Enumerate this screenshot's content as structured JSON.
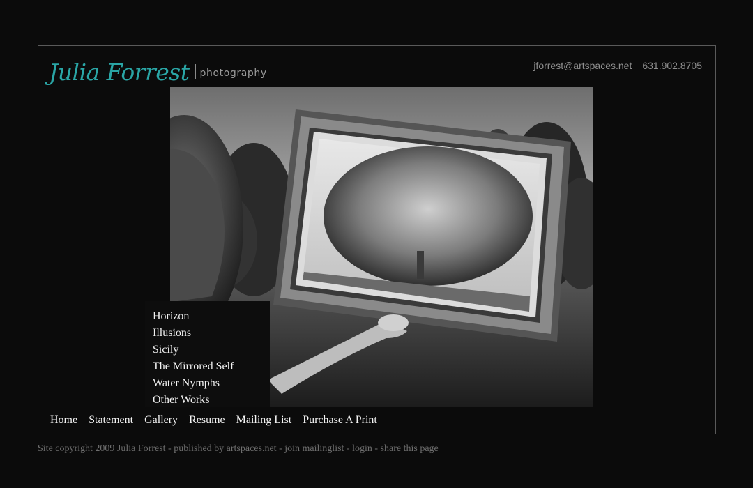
{
  "header": {
    "logo_name": "Julia Forrest",
    "logo_subtitle": "photography",
    "email": "jforrest@artspaces.net",
    "phone": "631.902.8705"
  },
  "photo": {
    "icon": "photograph-woman-holding-frame"
  },
  "submenu": {
    "items": [
      {
        "label": "Horizon"
      },
      {
        "label": "Illusions"
      },
      {
        "label": "Sicily"
      },
      {
        "label": "The Mirrored Self"
      },
      {
        "label": "Water Nymphs"
      },
      {
        "label": "Other Works"
      }
    ]
  },
  "nav": {
    "items": [
      {
        "label": "Home"
      },
      {
        "label": "Statement"
      },
      {
        "label": "Gallery"
      },
      {
        "label": "Resume"
      },
      {
        "label": "Mailing List"
      },
      {
        "label": "Purchase A Print"
      }
    ]
  },
  "footer": {
    "copyright": "Site copyright 2009 Julia Forrest",
    "sep1": " - ",
    "published": "published by artspaces.net",
    "sep2": " - ",
    "join": "join mailinglist",
    "sep3": " - ",
    "login": "login",
    "sep4": " - ",
    "share": "share this page"
  },
  "colors": {
    "background": "#0b0b0b",
    "logo_accent": "#2aa6a6",
    "nav_text": "#f4f4f4",
    "muted_text": "#6e6e6e"
  }
}
